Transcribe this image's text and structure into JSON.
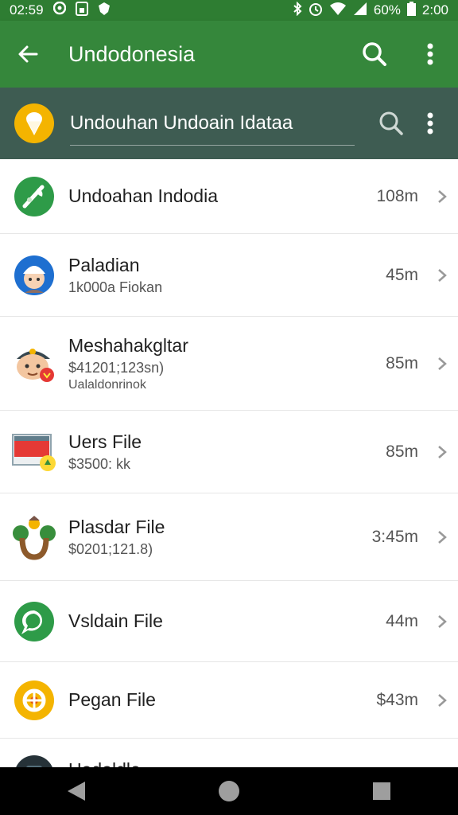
{
  "status_bar": {
    "time_left": "02:59",
    "battery_percent": "60%",
    "time_right": "2:00"
  },
  "app_bar": {
    "title": "Undodonesia"
  },
  "search": {
    "value": "Undouhan Undoain Idataa"
  },
  "files": [
    {
      "title": "Undoahan Indodia",
      "subtitle": "",
      "subtitle2": "",
      "size": "108m",
      "icon": "green-leaf-icon"
    },
    {
      "title": "Paladian",
      "subtitle": "1k000a Fiokan",
      "subtitle2": "",
      "size": "45m",
      "icon": "person-avatar-icon"
    },
    {
      "title": "Meshahakgltar",
      "subtitle": "$41201;123sn)",
      "subtitle2": "Ualaldonrinok",
      "size": "85m",
      "icon": "character-avatar-icon"
    },
    {
      "title": "Uers File",
      "subtitle": "$3500: kk",
      "subtitle2": "",
      "size": "85m",
      "icon": "image-file-icon"
    },
    {
      "title": "Plasdar File",
      "subtitle": "$0201;121.8)",
      "subtitle2": "",
      "size": "3:45m",
      "icon": "tree-icon"
    },
    {
      "title": "Vsldain File",
      "subtitle": "",
      "subtitle2": "",
      "size": "44m",
      "icon": "chat-bubble-icon"
    },
    {
      "title": "Pegan File",
      "subtitle": "",
      "subtitle2": "",
      "size": "$43m",
      "icon": "gear-badge-icon"
    },
    {
      "title": "Uadaldle",
      "subtitle": "",
      "subtitle2": "",
      "size": "",
      "icon": "dark-app-icon"
    }
  ],
  "colors": {
    "status_bar": "#2e7d32",
    "app_bar": "#35873b",
    "search_bar": "#3e5c52",
    "accent_yellow": "#f4b400",
    "accent_green": "#2e9b48"
  }
}
